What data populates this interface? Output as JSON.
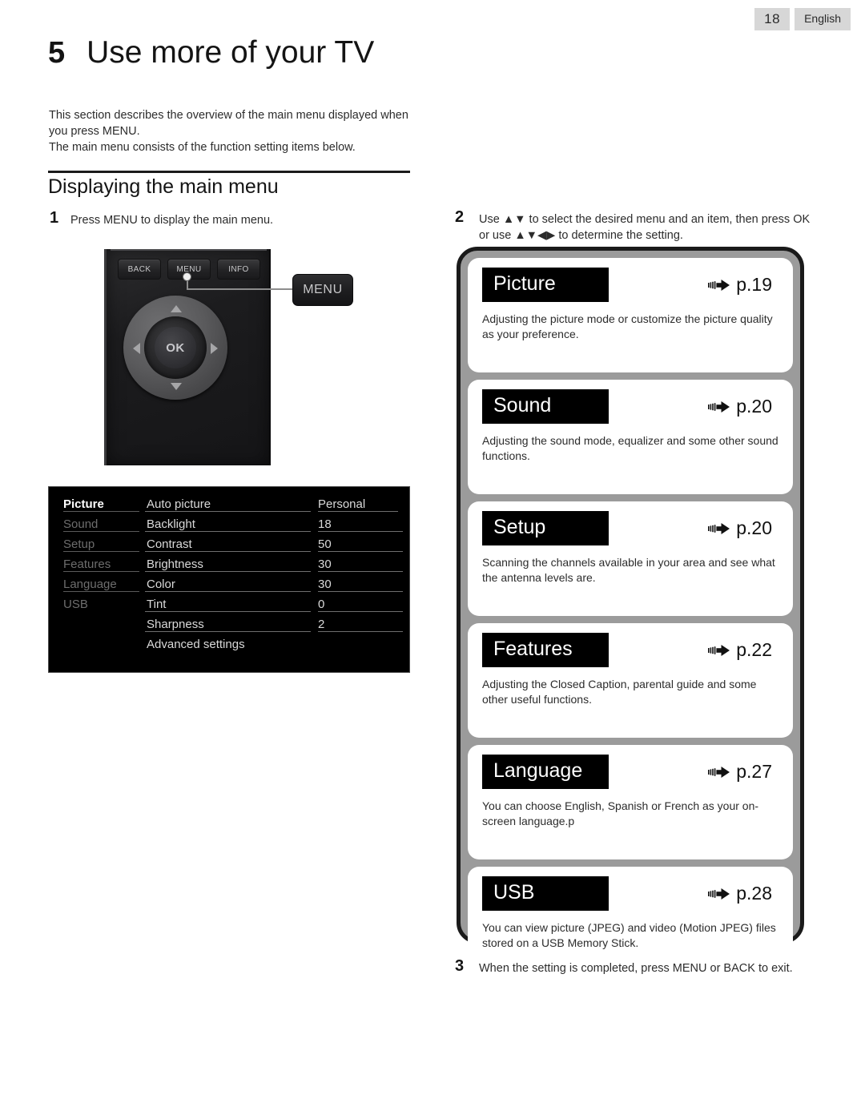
{
  "header": {
    "page_number": "18",
    "language": "English"
  },
  "chapter": {
    "number": "5",
    "title": "Use more of your TV"
  },
  "intro": {
    "line1": "This section describes the overview of the main menu displayed when",
    "line2": "you press MENU.",
    "line3": "The main menu consists of the function setting items below."
  },
  "section": {
    "heading": "Displaying the main menu"
  },
  "steps": [
    {
      "number": "1",
      "text": "Press MENU to display the main menu."
    },
    {
      "number": "2",
      "line1": "Use ▲▼ to select the desired menu and an item, then press OK",
      "line2": "or use ▲▼◀▶ to determine the setting."
    },
    {
      "number": "3",
      "text": "When the setting is completed, press MENU or BACK to exit."
    }
  ],
  "remote": {
    "buttons": [
      {
        "label": "BACK",
        "name": "back-button"
      },
      {
        "label": "MENU",
        "name": "menu-button"
      },
      {
        "label": "INFO",
        "name": "info-button"
      }
    ],
    "dpad_ok": "OK",
    "callout_label": "MENU"
  },
  "osd_menu": {
    "categories": [
      {
        "label": "Picture",
        "active": true
      },
      {
        "label": "Sound",
        "active": false
      },
      {
        "label": "Setup",
        "active": false
      },
      {
        "label": "Features",
        "active": false
      },
      {
        "label": "Language",
        "active": false
      },
      {
        "label": "USB",
        "active": false
      }
    ],
    "settings": [
      {
        "name": "Auto picture",
        "value": "Personal"
      },
      {
        "name": "Backlight",
        "value": "18"
      },
      {
        "name": "Contrast",
        "value": "50"
      },
      {
        "name": "Brightness",
        "value": "30"
      },
      {
        "name": "Color",
        "value": "30"
      },
      {
        "name": "Tint",
        "value": "0"
      },
      {
        "name": "Sharpness",
        "value": "2"
      },
      {
        "name": "Advanced settings",
        "value": ""
      }
    ]
  },
  "menu_panels": [
    {
      "label": "Picture",
      "page": "p.19",
      "desc": "Adjusting the picture mode or customize the picture quality as your preference."
    },
    {
      "label": "Sound",
      "page": "p.20",
      "desc": "Adjusting the sound mode, equalizer and some other sound functions."
    },
    {
      "label": "Setup",
      "page": "p.20",
      "desc": "Scanning the channels available in your area and see what the antenna levels are."
    },
    {
      "label": "Features",
      "page": "p.22",
      "desc": "Adjusting the Closed Caption, parental guide and some other useful functions."
    },
    {
      "label": "Language",
      "page": "p.27",
      "desc": "You can choose English, Spanish or French as your on-screen language.p"
    },
    {
      "label": "USB",
      "page": "p.28",
      "desc": "You can view picture (JPEG) and video (Motion JPEG) files stored on a USB Memory Stick."
    }
  ],
  "colors": {
    "page_badge_bg": "#d7d7d7",
    "panel_frame_border": "#1a1a1a",
    "panel_frame_bg": "#9b9b9b",
    "label_block_bg": "#000000",
    "osd_bg": "#000000",
    "osd_active_text": "#ffffff",
    "osd_dim_text": "#6d6d6d"
  }
}
